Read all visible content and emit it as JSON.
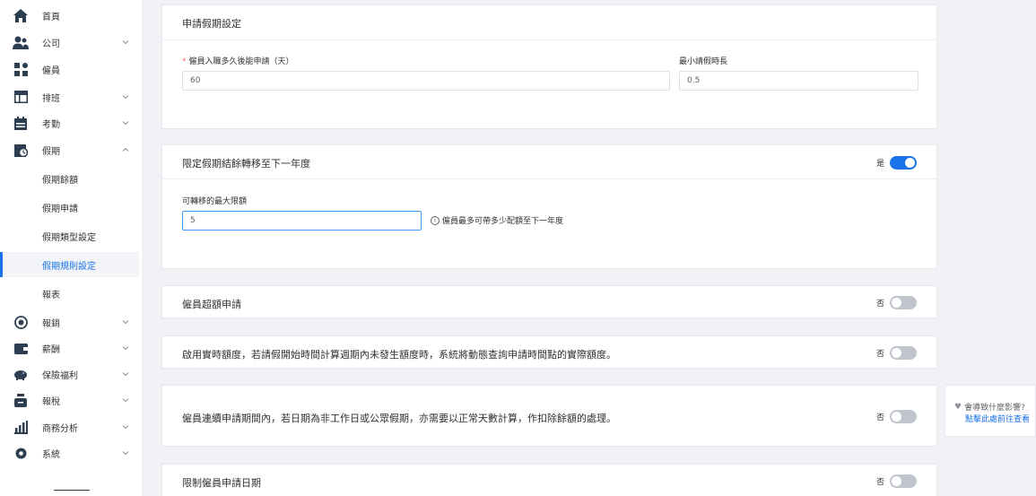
{
  "sidebar": {
    "items": [
      {
        "label": "首頁",
        "icon": "home-icon"
      },
      {
        "label": "公司",
        "icon": "users-icon"
      },
      {
        "label": "僱員",
        "icon": "grid-icon"
      },
      {
        "label": "排班",
        "icon": "table-icon"
      },
      {
        "label": "考勤",
        "icon": "calendar-icon"
      },
      {
        "label": "假期",
        "icon": "leave-icon"
      },
      {
        "label": "報銷",
        "icon": "target-icon"
      },
      {
        "label": "薪酬",
        "icon": "wallet-icon"
      },
      {
        "label": "保險福利",
        "icon": "piggy-bank-icon"
      },
      {
        "label": "報稅",
        "icon": "money-bag-icon"
      },
      {
        "label": "商務分析",
        "icon": "bar-chart-icon"
      },
      {
        "label": "系統",
        "icon": "gear-icon"
      }
    ],
    "leave_sub": [
      "假期餘額",
      "假期申請",
      "假期類型設定",
      "假期規則設定",
      "報表"
    ],
    "active_sub": "假期規則設定"
  },
  "cards": {
    "apply_settings": {
      "title": "申請假期設定",
      "field1_label": "僱員入職多久後能申請（天）",
      "field1_value": "60",
      "field2_label": "最小請假時長",
      "field2_value": "0.5"
    },
    "carry_over": {
      "title": "限定假期結餘轉移至下一年度",
      "switch_text": "是",
      "field_label": "可轉移的最大限額",
      "field_value": "5",
      "hint": "僱員最多可帶多少配額至下一年度"
    },
    "over_quota": {
      "title": "僱員超額申請",
      "switch_text": "否"
    },
    "realtime_quota": {
      "title": "啟用實時額度，若請假開始時間計算週期內未發生額度時，系統將動態查詢申請時間點的實際額度。",
      "switch_text": "否"
    },
    "continuous_leave": {
      "title": "僱員連續申請期間內，若日期為非工作日或公眾假期，亦需要以正常天數計算，作扣除餘額的處理。",
      "switch_text": "否"
    },
    "limit_date": {
      "title": "限制僱員申請日期",
      "switch_text": "否"
    }
  },
  "help": {
    "question": "會導致什麼影響?",
    "link": "點擊此處前往查看"
  },
  "colors": {
    "accent": "#1a73e8",
    "switch_off": "#c0c4cc"
  }
}
